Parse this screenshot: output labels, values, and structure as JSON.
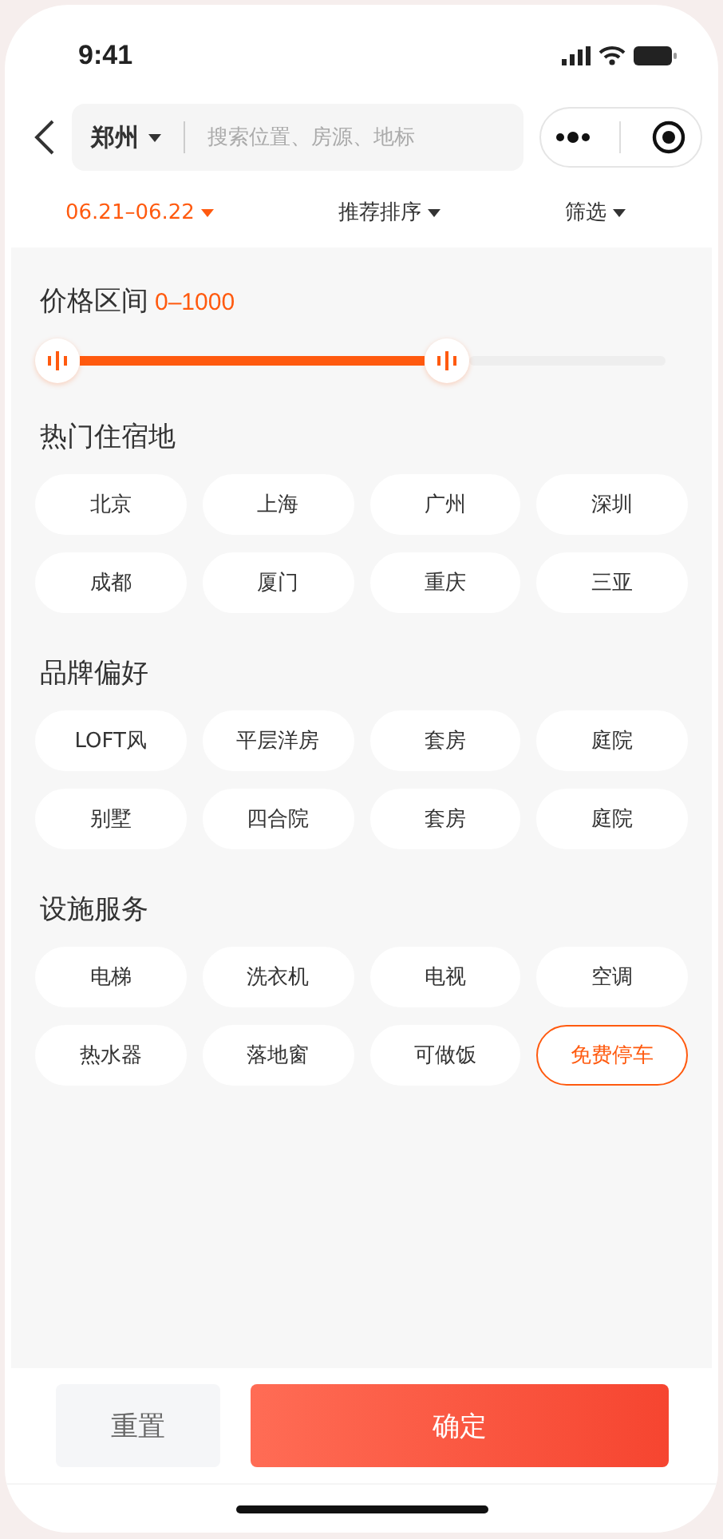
{
  "status_bar": {
    "time": "9:41"
  },
  "search": {
    "city": "郑州",
    "placeholder": "搜索位置、房源、地标"
  },
  "sort_bar": [
    {
      "label": "06.21–06.22",
      "selected": true
    },
    {
      "label": "推荐排序",
      "selected": false
    },
    {
      "label": "筛选",
      "selected": false
    }
  ],
  "price": {
    "title": "价格区间",
    "range": "0–1000",
    "thumbs": [
      {
        "level": 0
      },
      {
        "level": 0.64
      }
    ]
  },
  "sections": [
    {
      "title": "热门住宿地",
      "options": [
        {
          "label": "北京",
          "selected": false
        },
        {
          "label": "上海",
          "selected": false
        },
        {
          "label": "广州",
          "selected": false
        },
        {
          "label": "深圳",
          "selected": false
        },
        {
          "label": "成都",
          "selected": false
        },
        {
          "label": "厦门",
          "selected": false
        },
        {
          "label": "重庆",
          "selected": false
        },
        {
          "label": "三亚",
          "selected": false
        }
      ]
    },
    {
      "title": "品牌偏好",
      "options": [
        {
          "label": "LOFT风",
          "selected": false
        },
        {
          "label": "平层洋房",
          "selected": false
        },
        {
          "label": "套房",
          "selected": false
        },
        {
          "label": "庭院",
          "selected": false
        },
        {
          "label": "别墅",
          "selected": false
        },
        {
          "label": "四合院",
          "selected": false
        },
        {
          "label": "套房",
          "selected": false
        },
        {
          "label": "庭院",
          "selected": false
        }
      ]
    },
    {
      "title": "设施服务",
      "options": [
        {
          "label": "电梯",
          "selected": false
        },
        {
          "label": "洗衣机",
          "selected": false
        },
        {
          "label": "电视",
          "selected": false
        },
        {
          "label": "空调",
          "selected": false
        },
        {
          "label": "热水器",
          "selected": false
        },
        {
          "label": "落地窗",
          "selected": false
        },
        {
          "label": "可做饭",
          "selected": false
        },
        {
          "label": "免费停车",
          "selected": true
        }
      ]
    }
  ],
  "buttons": {
    "reset": "重置",
    "confirm": "确定"
  }
}
